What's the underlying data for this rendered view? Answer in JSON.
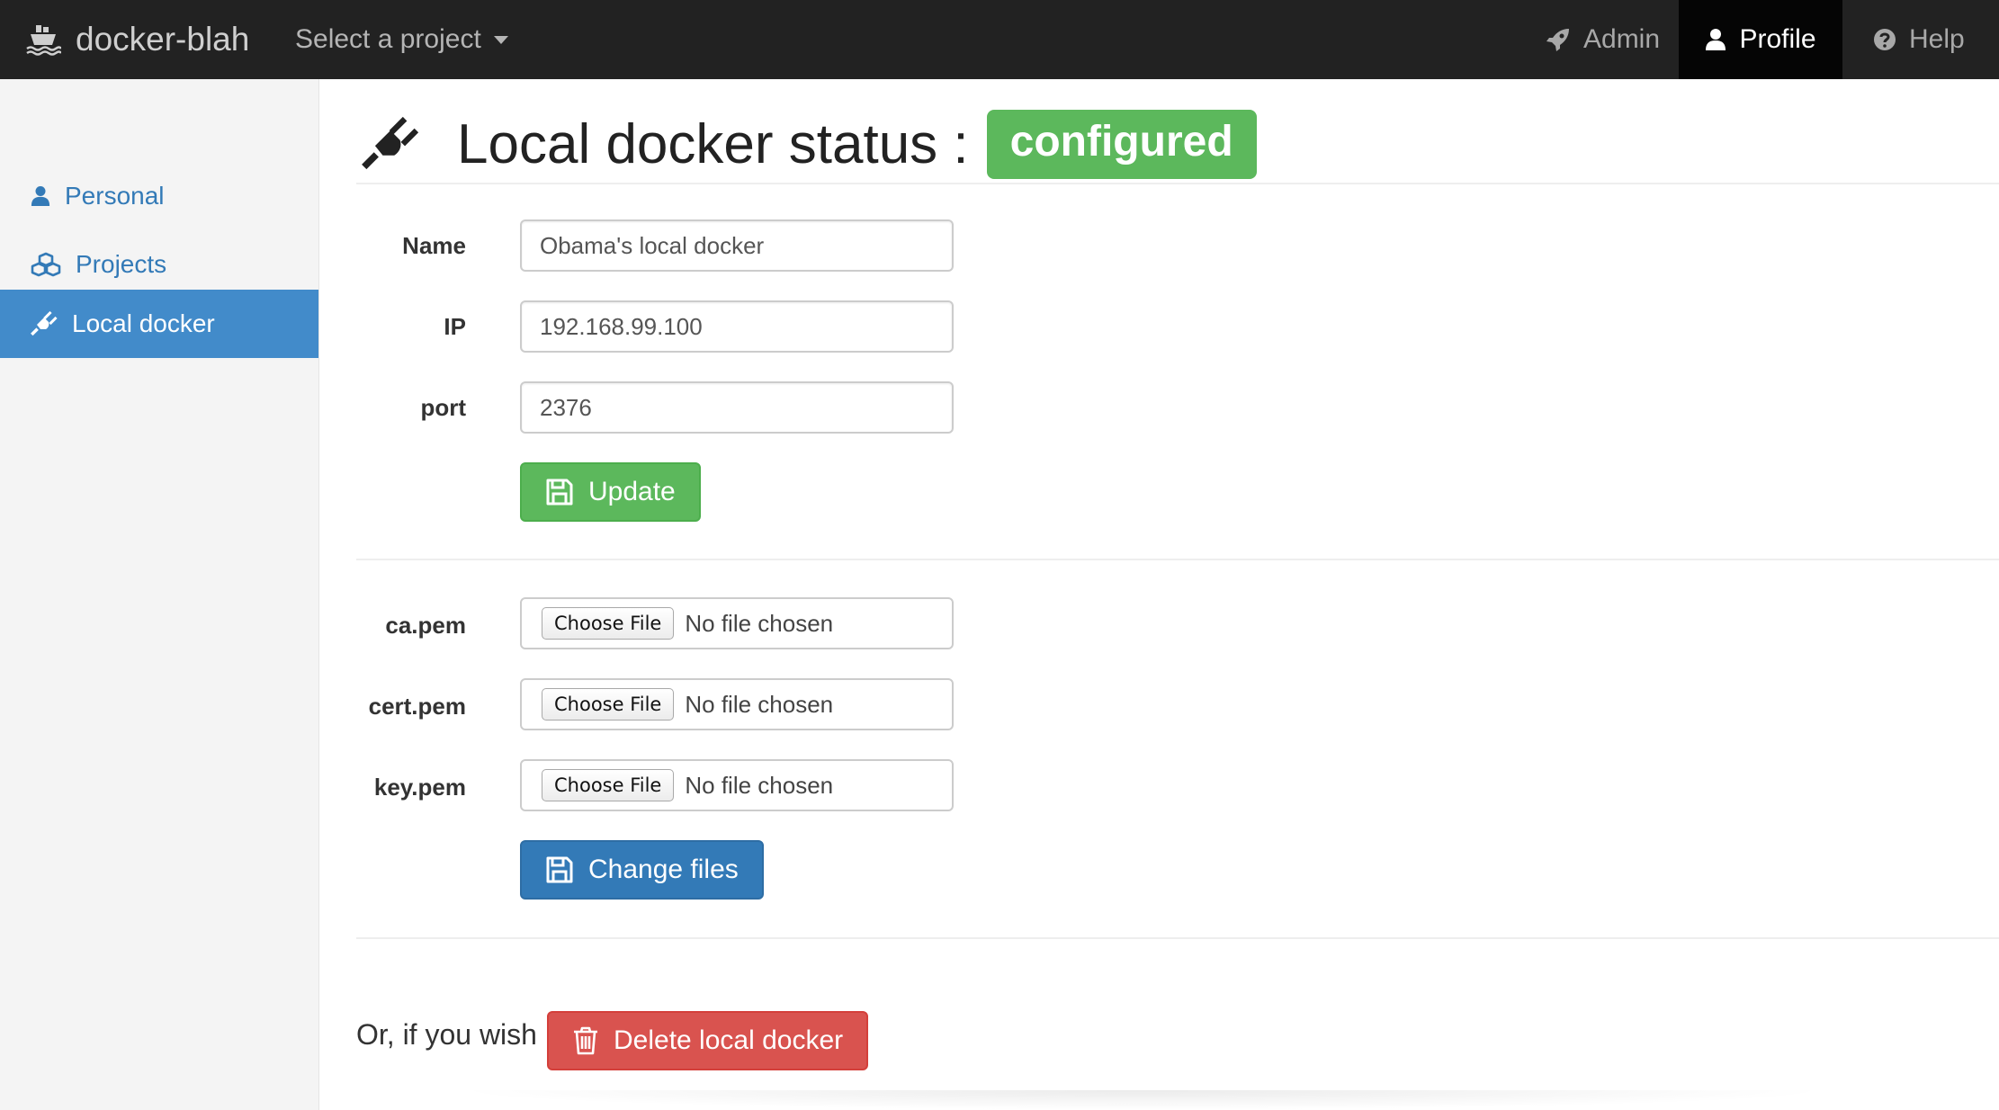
{
  "navbar": {
    "brand": "docker-blah",
    "project_select": "Select a project",
    "admin": "Admin",
    "profile": "Profile",
    "help": "Help"
  },
  "sidebar": {
    "items": [
      {
        "label": "Personal",
        "icon": "user-icon",
        "active": false
      },
      {
        "label": "Projects",
        "icon": "cubes-icon",
        "active": false
      },
      {
        "label": "Local docker",
        "icon": "plug-icon",
        "active": true
      }
    ]
  },
  "main": {
    "title": "Local docker status :",
    "status": "configured",
    "form": {
      "name_label": "Name",
      "name_value": "Obama's local docker",
      "ip_label": "IP",
      "ip_value": "192.168.99.100",
      "port_label": "port",
      "port_value": "2376",
      "update_button": "Update"
    },
    "files": {
      "choose_label": "Choose File",
      "no_file": "No file chosen",
      "items": [
        {
          "label": "ca.pem"
        },
        {
          "label": "cert.pem"
        },
        {
          "label": "key.pem"
        }
      ],
      "change_button": "Change files"
    },
    "delete": {
      "prompt": "Or, if you wish",
      "button": "Delete local docker"
    }
  },
  "colors": {
    "navbar_bg": "#222222",
    "success": "#5cb85c",
    "primary": "#337ab7",
    "danger": "#d9534f",
    "sidebar_active": "#428bca"
  }
}
